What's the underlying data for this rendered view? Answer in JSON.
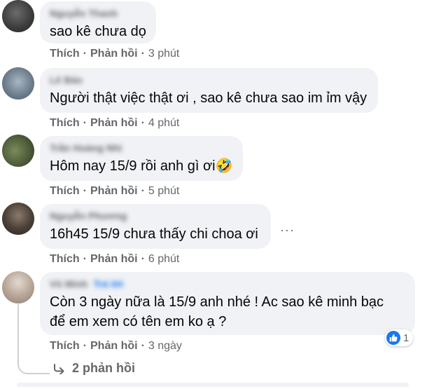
{
  "comments": [
    {
      "author": "Nguyễn Thanh",
      "text": "sao kê chưa dọ",
      "like": "Thích",
      "reply": "Phản hồi",
      "time": "3 phút"
    },
    {
      "author": "Lê Bảo",
      "text": "Người thật việc thật ơi , sao kê chưa sao im ỉm vậy",
      "like": "Thích",
      "reply": "Phản hồi",
      "time": "4 phút"
    },
    {
      "author": "Trần Hoàng Nhi",
      "text": "Hôm nay 15/9 rồi anh gì ơi",
      "emoji": "🤣",
      "like": "Thích",
      "reply": "Phản hồi",
      "time": "5 phút"
    },
    {
      "author": "Nguyễn Phương",
      "text": "16h45 15/9 chưa thấy chi choa ơi",
      "like": "Thích",
      "reply": "Phản hồi",
      "time": "6 phút"
    },
    {
      "author": "Vũ Minh",
      "author_tag": "Trả lời",
      "text_lines": [
        "Còn 3 ngày nữa là 15/9 anh nhé ! Ac sao kê minh bạc",
        "để em xem có tên em ko ạ ?"
      ],
      "like": "Thích",
      "reply": "Phản hồi",
      "time": "3 ngày",
      "reaction_count": "1"
    }
  ],
  "more_options": "···",
  "replies_link": "2 phản hồi",
  "colors": {
    "bubble": "#f0f2f5",
    "meta": "#65676b",
    "like_blue": "#1877f2"
  }
}
